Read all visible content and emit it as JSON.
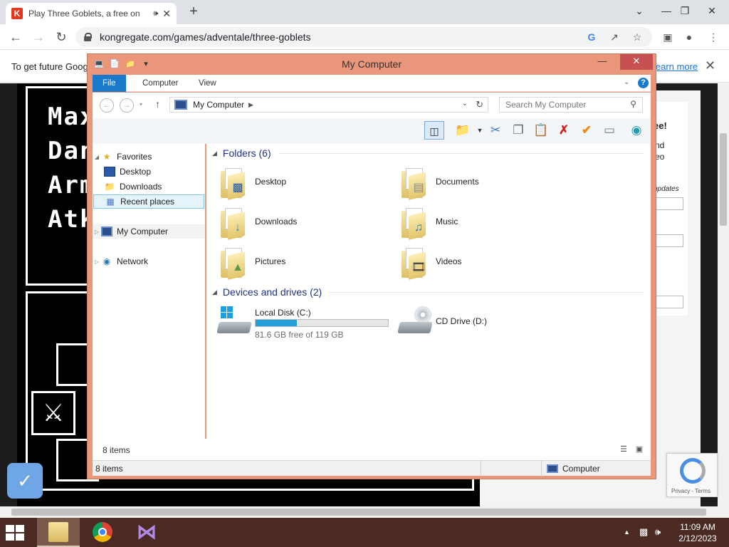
{
  "browser": {
    "tab_title": "Play Three Goblets, a free on",
    "favicon_letter": "K",
    "url": "kongregate.com/games/adventale/three-goblets",
    "infobar_message": "To get future Goog",
    "infobar_link": "learn more"
  },
  "game": {
    "stats": [
      "Max",
      "Dan",
      "Arm",
      "Atk"
    ],
    "side_texts": [
      "ee!",
      "nd",
      "eo",
      "updates"
    ]
  },
  "recaptcha": {
    "label": "Privacy - Terms"
  },
  "explorer": {
    "title": "My Computer",
    "ribbon_tabs": [
      "File",
      "Computer",
      "View"
    ],
    "address_crumb": "My Computer",
    "search_placeholder": "Search My Computer",
    "nav": {
      "favorites": "Favorites",
      "desktop": "Desktop",
      "downloads": "Downloads",
      "recent": "Recent places",
      "my_computer": "My Computer",
      "network": "Network"
    },
    "folders_header": "Folders (6)",
    "folders": [
      "Desktop",
      "Documents",
      "Downloads",
      "Music",
      "Pictures",
      "Videos"
    ],
    "drives_header": "Devices and drives (2)",
    "drives": [
      {
        "name": "Local Disk (C:)",
        "free_text": "81.6 GB free of 119 GB",
        "used_fraction": 0.314
      },
      {
        "name": "CD Drive (D:)"
      }
    ],
    "status_count": "8 items",
    "footer_count": "8 items",
    "footer_location": "Computer"
  },
  "taskbar": {
    "time": "11:09 AM",
    "date": "2/12/2023"
  },
  "colors": {
    "window_frame": "#e9967a",
    "taskbar": "#4a2a22",
    "accent_blue": "#1979ca",
    "drive_fill": "#26a0da"
  }
}
